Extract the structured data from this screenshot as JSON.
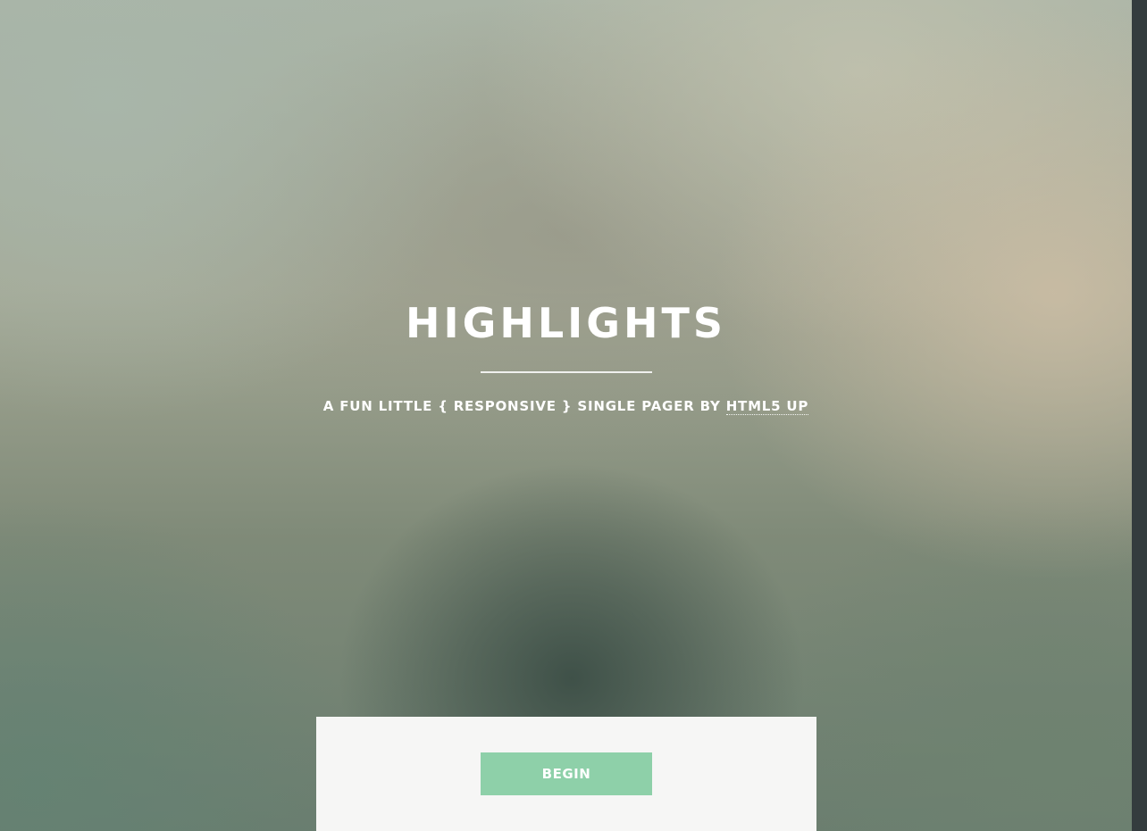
{
  "hero": {
    "title": "HIGHLIGHTS",
    "tagline_prefix": "A FUN LITTLE { RESPONSIVE } SINGLE PAGER BY ",
    "tagline_link": "HTML5 UP"
  },
  "panel": {
    "begin_label": "BEGIN"
  },
  "colors": {
    "button_bg": "#8ed0a9",
    "panel_bg": "#f6f6f5",
    "scrollbar": "#343c3e",
    "text": "#ffffff"
  }
}
